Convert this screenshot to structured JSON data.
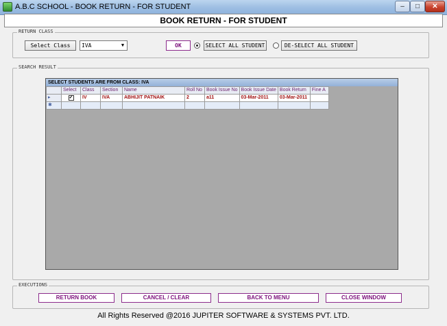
{
  "window": {
    "title": "A.B.C SCHOOL - BOOK RETURN - FOR STUDENT",
    "min": "–",
    "max": "□",
    "close": "✕"
  },
  "header": {
    "title": "BOOK RETURN - FOR STUDENT"
  },
  "return_class": {
    "group_label": "RETURN CLASS",
    "select_class_label": "Select Class",
    "class_value": "IVA",
    "ok_label": "OK",
    "select_all_label": "SELECT ALL STUDENT",
    "deselect_all_label": "DE-SELECT ALL STUDENT",
    "selected_radio": "select_all"
  },
  "search_result": {
    "group_label": "SEARCH RESULT",
    "caption": "SELECT STUDENTS ARE FROM CLASS: IVA",
    "columns": [
      "Select",
      "Class",
      "Section",
      "Name",
      "Roll No",
      "Book Issue No",
      "Book Issue Date",
      "Book Return",
      "Fine A"
    ],
    "rows": [
      {
        "select": true,
        "class": "IV",
        "section": "IVA",
        "name": "ABHIJIT PATNAIK",
        "roll": "2",
        "issue_no": "a11",
        "issue_date": "03-Mar-2011",
        "return_date": "03-Mar-2011",
        "fine": ""
      }
    ]
  },
  "executions": {
    "group_label": "EXECUTIONS",
    "return_book": "RETURN BOOK",
    "cancel_clear": "CANCEL / CLEAR",
    "back_to_menu": "BACK TO MENU",
    "close_window": "CLOSE WINDOW"
  },
  "footer": "All Rights Reserved @2016 JUPITER SOFTWARE & SYSTEMS PVT. LTD."
}
